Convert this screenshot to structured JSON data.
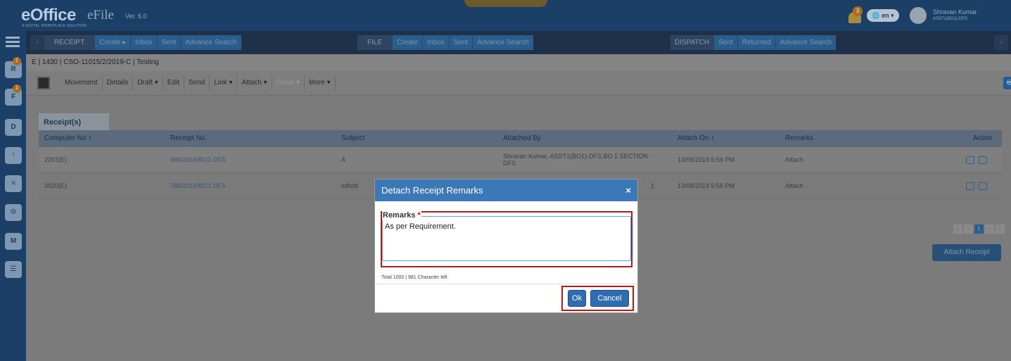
{
  "header": {
    "logo": "eOffice",
    "logo_sub": "A DIGITAL WORKPLACE SOLUTION",
    "app_name": "eFile",
    "version": "Ver. 6.0",
    "notification_count": "3",
    "language": "en",
    "user_name": "Shravan Kumar",
    "user_role": "ASST1(BO1)-DFS"
  },
  "sidebar": {
    "items": [
      {
        "name": "receipt-module-icon",
        "label": "R",
        "badge": "1"
      },
      {
        "name": "file-module-icon",
        "label": "F",
        "badge": "1"
      },
      {
        "name": "dak-module-icon",
        "label": "D",
        "badge": ""
      },
      {
        "name": "upload-icon",
        "label": "↑",
        "badge": ""
      },
      {
        "name": "tools-icon",
        "label": "≡",
        "badge": ""
      },
      {
        "name": "settings-icon",
        "label": "⚙",
        "badge": ""
      },
      {
        "name": "mail-icon",
        "label": "M",
        "badge": ""
      },
      {
        "name": "users-icon",
        "label": "☰",
        "badge": ""
      }
    ]
  },
  "nav": {
    "receipt": {
      "label": "RECEIPT",
      "items": [
        "Create ▸",
        "Inbox",
        "Sent",
        "Advance Search"
      ]
    },
    "file": {
      "label": "FILE",
      "items": [
        "Create",
        "Inbox",
        "Sent",
        "Advance Search"
      ]
    },
    "dispatch": {
      "label": "DISPATCH",
      "items": [
        "Sent",
        "Returned",
        "Advance Search"
      ]
    }
  },
  "breadcrumb": "E | 1430 | CSO-11015/2/2019-C | Testing",
  "toolbar": {
    "items": [
      "Movement",
      "Details",
      "Draft ▾",
      "Edit",
      "Send",
      "Link ▾",
      "Attach ▾",
      "Close ▾",
      "More ▾"
    ]
  },
  "receipts": {
    "tab_label": "Receipt(s)",
    "columns": [
      "Computer No ↕",
      "Receipt No.",
      "Subject",
      "Attached By",
      "Attach On ↕",
      "Remarks",
      "Action"
    ],
    "rows": [
      {
        "computer_no": "2207(E)",
        "receipt_no": "986/2019/BO1-DFS",
        "subject": "A",
        "attached_by": "Shravan Kumar, ASST1(BO1)-DFS,BO 1 SECTION - DFS",
        "attach_on": "13/09/2019 5:56 PM",
        "remarks": "Attach"
      },
      {
        "computer_no": "2020(E)",
        "receipt_no": "788/2019/BO1-DFS",
        "subject": "sdfsfd",
        "attached_by": "1",
        "attach_on": "13/09/2019 5:56 PM",
        "remarks": "Attach"
      }
    ],
    "pager": [
      "«",
      "‹",
      "1",
      "›",
      "»"
    ],
    "attach_button": "Attach Receipt"
  },
  "dialog": {
    "title": "Detach Receipt Remarks",
    "close": "×",
    "remarks_label": "Remarks",
    "required_mark": "*",
    "remarks_value": "As per Requirement.",
    "counter": "Total 1000 | 981 Character left",
    "ok": "Ok",
    "cancel": "Cancel"
  },
  "colors": {
    "header_bg": "#1b3f66",
    "dialog_header": "#3a78b8",
    "highlight": "#b01c1c",
    "button": "#2f6db2"
  }
}
